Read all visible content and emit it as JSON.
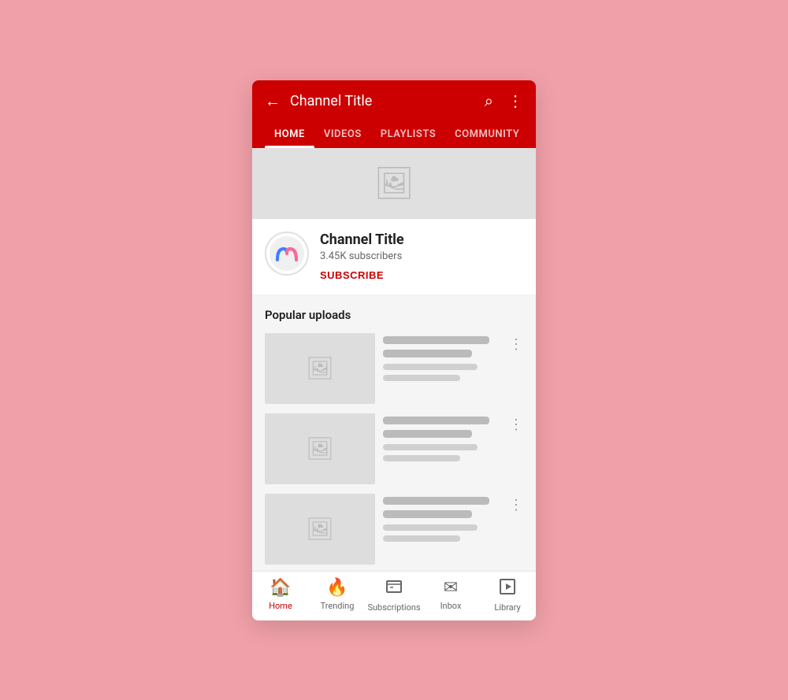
{
  "topBar": {
    "channelTitle": "Channel Title",
    "backIcon": "←",
    "searchIcon": "⌕",
    "moreIcon": "⋮"
  },
  "tabs": [
    {
      "id": "home",
      "label": "HOME",
      "active": true
    },
    {
      "id": "videos",
      "label": "VIDEOS",
      "active": false
    },
    {
      "id": "playlists",
      "label": "PLAYLISTS",
      "active": false
    },
    {
      "id": "community",
      "label": "COMMUNITY",
      "active": false
    }
  ],
  "channel": {
    "name": "Channel Title",
    "subscribers": "3.45K subscribers",
    "subscribeLabel": "SUBSCRIBE"
  },
  "content": {
    "sectionTitle": "Popular uploads"
  },
  "bottomNav": [
    {
      "id": "home",
      "label": "Home",
      "icon": "🏠",
      "active": true
    },
    {
      "id": "trending",
      "label": "Trending",
      "icon": "🔥",
      "active": false
    },
    {
      "id": "subscriptions",
      "label": "Subscriptions",
      "icon": "▤",
      "active": false
    },
    {
      "id": "inbox",
      "label": "Inbox",
      "icon": "✉",
      "active": false
    },
    {
      "id": "library",
      "label": "Library",
      "icon": "▶",
      "active": false
    }
  ]
}
